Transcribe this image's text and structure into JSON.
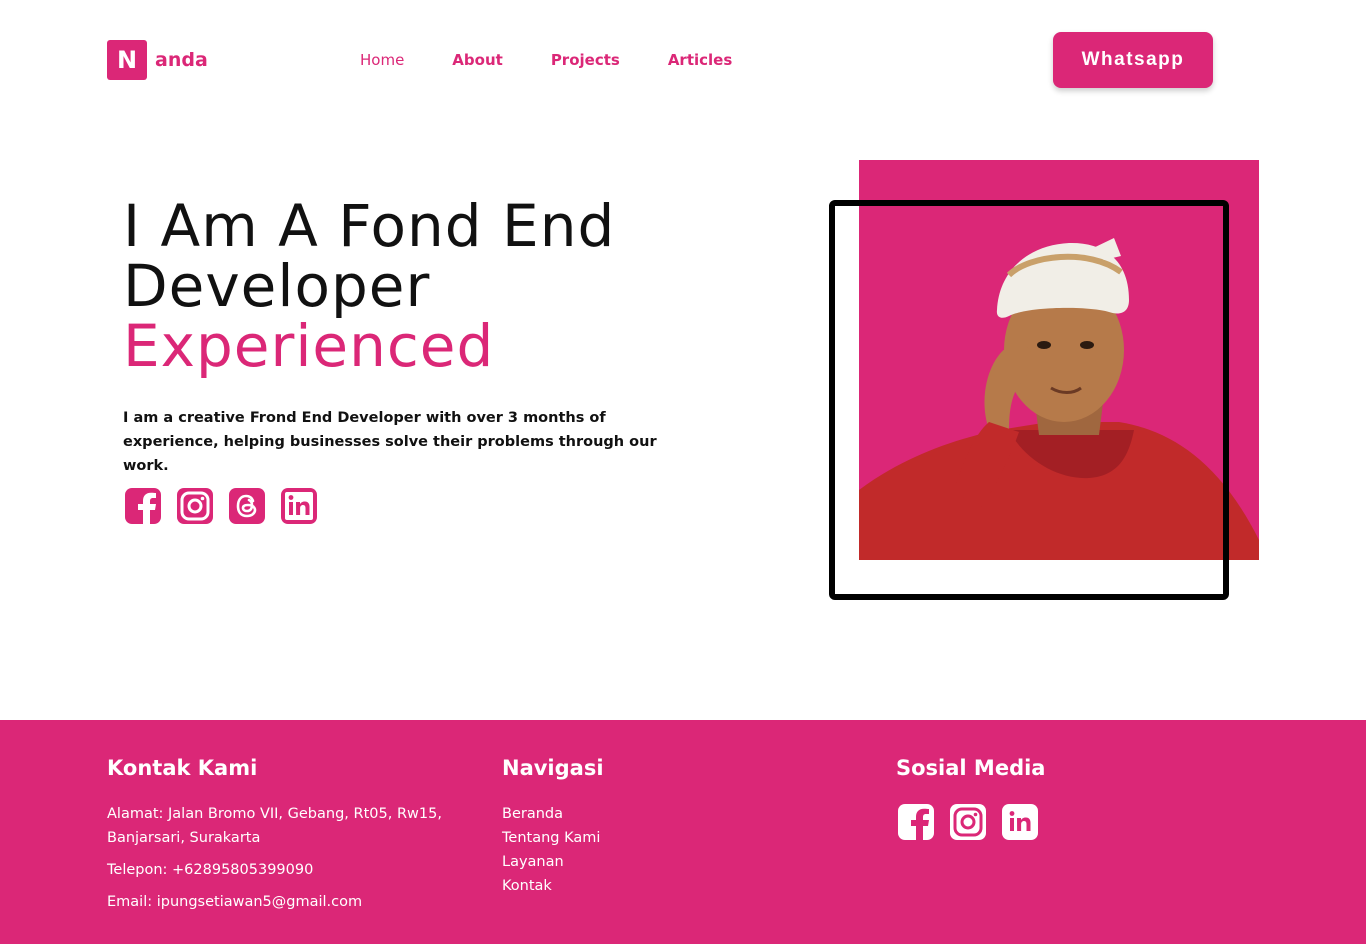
{
  "header": {
    "logo_letter": "N",
    "logo_text": "anda",
    "nav": [
      {
        "label": "Home"
      },
      {
        "label": "About"
      },
      {
        "label": "Projects"
      },
      {
        "label": "Articles"
      }
    ],
    "cta_label": "Whatsapp"
  },
  "hero": {
    "title_line1": "I Am A Fond End",
    "title_line2": "Developer",
    "title_accent": "Experienced",
    "description": "I am a creative Frond End Developer with over 3 months of experience, helping businesses solve their problems through our work.",
    "social_icons": [
      "facebook-icon",
      "instagram-icon",
      "threads-icon",
      "linkedin-icon"
    ]
  },
  "photo": {
    "alt": "profile-photo"
  },
  "footer": {
    "contact": {
      "heading": "Kontak Kami",
      "address": "Alamat: Jalan Bromo VII, Gebang, Rt05, Rw15, Banjarsari, Surakarta",
      "phone": "Telepon: +628958053990​90",
      "email": "Email: ipungsetiawan5@gmail.com"
    },
    "navigation": {
      "heading": "Navigasi",
      "links": [
        "Beranda",
        "Tentang Kami",
        "Layanan",
        "Kontak"
      ]
    },
    "social": {
      "heading": "Sosial Media",
      "icons": [
        "facebook-icon",
        "instagram-icon",
        "linkedin-icon"
      ]
    }
  },
  "colors": {
    "accent": "#db2777",
    "text": "#111111",
    "background": "#ffffff"
  }
}
